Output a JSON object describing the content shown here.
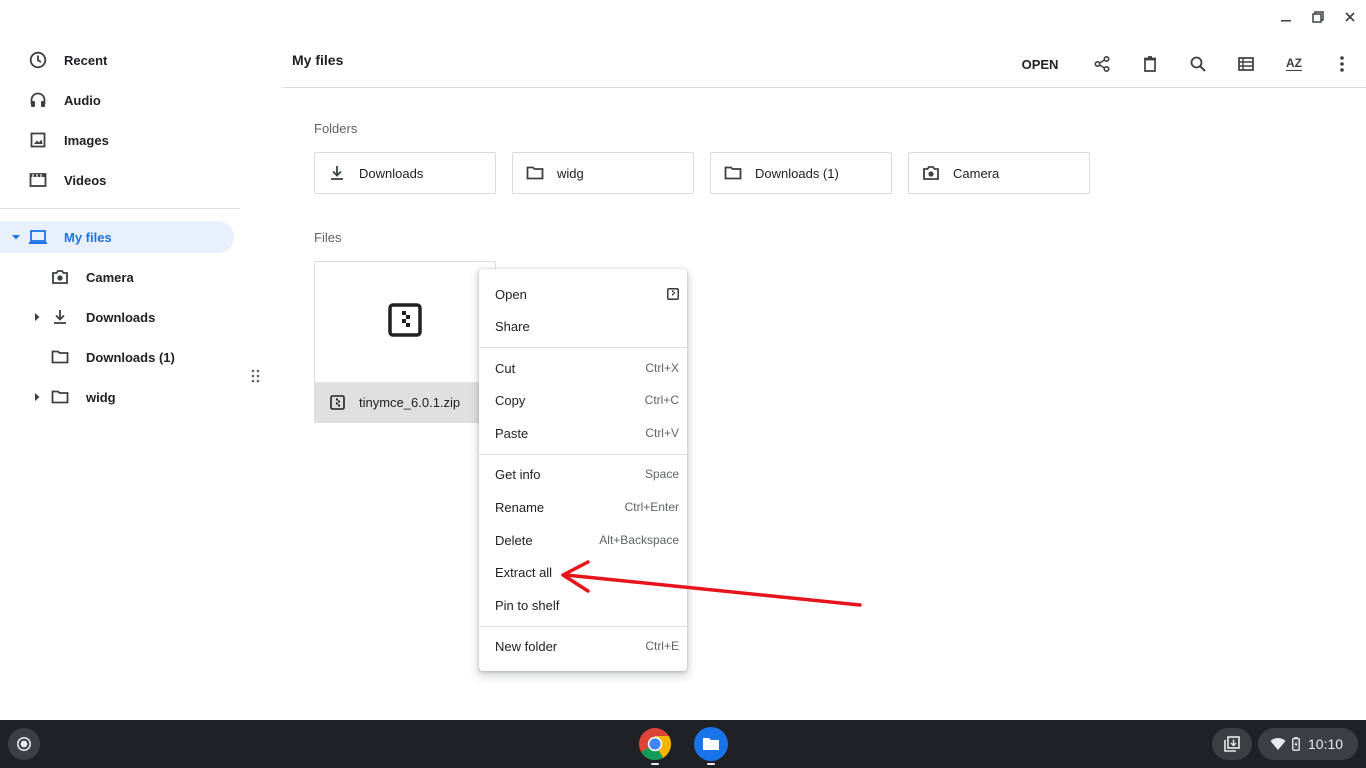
{
  "sidebar": {
    "items": [
      {
        "label": "Recent",
        "icon": "clock-icon"
      },
      {
        "label": "Audio",
        "icon": "headphones-icon"
      },
      {
        "label": "Images",
        "icon": "image-icon"
      },
      {
        "label": "Videos",
        "icon": "film-icon"
      }
    ],
    "tree": [
      {
        "label": "My files",
        "icon": "laptop-icon",
        "active": true
      },
      {
        "label": "Camera",
        "icon": "camera-icon"
      },
      {
        "label": "Downloads",
        "icon": "download-icon"
      },
      {
        "label": "Downloads (1)",
        "icon": "folder-icon"
      },
      {
        "label": "widg",
        "icon": "folder-icon"
      }
    ]
  },
  "header": {
    "title": "My files",
    "open_label": "OPEN",
    "sort_label": "AZ"
  },
  "sections": {
    "folders_label": "Folders",
    "files_label": "Files"
  },
  "folders": [
    {
      "label": "Downloads",
      "icon": "download-icon"
    },
    {
      "label": "widg",
      "icon": "folder-icon"
    },
    {
      "label": "Downloads (1)",
      "icon": "folder-icon"
    },
    {
      "label": "Camera",
      "icon": "camera-icon"
    }
  ],
  "files": [
    {
      "name": "tinymce_6.0.1.zip",
      "icon": "zip-icon"
    }
  ],
  "context_menu": {
    "items": [
      {
        "label": "Open",
        "shortcut": ""
      },
      {
        "label": "Share",
        "shortcut": ""
      },
      {
        "label": "Cut",
        "shortcut": "Ctrl+X"
      },
      {
        "label": "Copy",
        "shortcut": "Ctrl+C"
      },
      {
        "label": "Paste",
        "shortcut": "Ctrl+V"
      },
      {
        "label": "Get info",
        "shortcut": "Space"
      },
      {
        "label": "Rename",
        "shortcut": "Ctrl+Enter"
      },
      {
        "label": "Delete",
        "shortcut": "Alt+Backspace"
      },
      {
        "label": "Extract all",
        "shortcut": ""
      },
      {
        "label": "Pin to shelf",
        "shortcut": ""
      },
      {
        "label": "New folder",
        "shortcut": "Ctrl+E"
      }
    ]
  },
  "shelf": {
    "time": "10:10",
    "apps": [
      "chrome-icon",
      "files-app-icon"
    ]
  },
  "colors": {
    "accent": "#1a73e8",
    "active_bg": "#e8f0fe",
    "annotation_arrow": "#e8141b",
    "shelf_bg": "#202124"
  }
}
